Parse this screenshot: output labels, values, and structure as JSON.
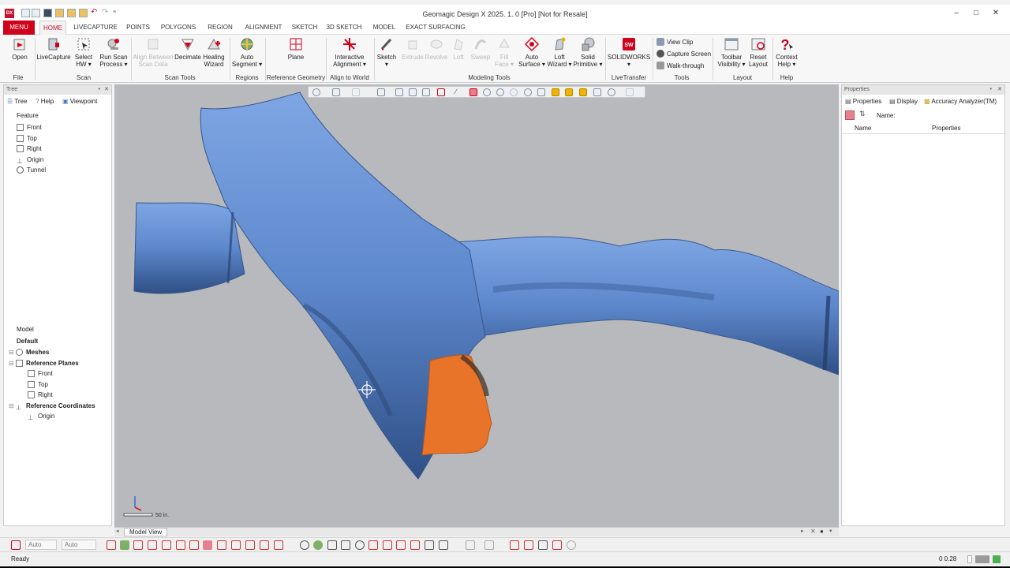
{
  "title_bar": {
    "app_logo": "DX",
    "title": "Geomagic Design X 2025. 1. 0 [Pro] [Not for Resale]"
  },
  "tabs": [
    "MENU",
    "HOME",
    "LIVECAPTURE",
    "POINTS",
    "POLYGONS",
    "REGION",
    "ALIGNMENT",
    "SKETCH",
    "3D SKETCH",
    "MODEL",
    "EXACT SURFACING"
  ],
  "ribbon": {
    "buttons": [
      {
        "l1": "Open",
        "l2": "",
        "icon": "open-icon",
        "enabled": true
      },
      {
        "l1": "LiveCapture",
        "l2": "",
        "icon": "livecapture-icon",
        "enabled": true
      },
      {
        "l1": "Select",
        "l2": "HW ▾",
        "icon": "select-hw-icon",
        "enabled": true
      },
      {
        "l1": "Run Scan",
        "l2": "Process ▾",
        "icon": "run-scan-icon",
        "enabled": true
      },
      {
        "l1": "Align Between",
        "l2": "Scan Data",
        "icon": "align-scan-icon",
        "enabled": false
      },
      {
        "l1": "Decimate",
        "l2": "",
        "icon": "decimate-icon",
        "enabled": true
      },
      {
        "l1": "Healing",
        "l2": "Wizard",
        "icon": "healing-icon",
        "enabled": true
      },
      {
        "l1": "Auto",
        "l2": "Segment ▾",
        "icon": "auto-segment-icon",
        "enabled": true
      },
      {
        "l1": "Plane",
        "l2": "",
        "icon": "plane-icon",
        "enabled": true
      },
      {
        "l1": "Interactive",
        "l2": "Alignment ▾",
        "icon": "interactive-alignment-icon",
        "enabled": true
      },
      {
        "l1": "Sketch",
        "l2": "▾",
        "icon": "sketch-icon",
        "enabled": true
      },
      {
        "l1": "Extrude",
        "l2": "",
        "icon": "extrude-icon",
        "enabled": false
      },
      {
        "l1": "Revolve",
        "l2": "",
        "icon": "revolve-icon",
        "enabled": false
      },
      {
        "l1": "Loft",
        "l2": "",
        "icon": "loft-icon",
        "enabled": false
      },
      {
        "l1": "Sweep",
        "l2": "",
        "icon": "sweep-icon",
        "enabled": false
      },
      {
        "l1": "Fill",
        "l2": "Face ▾",
        "icon": "fill-face-icon",
        "enabled": false
      },
      {
        "l1": "Auto",
        "l2": "Surface ▾",
        "icon": "auto-surface-icon",
        "enabled": true
      },
      {
        "l1": "Loft",
        "l2": "Wizard ▾",
        "icon": "loft-wizard-icon",
        "enabled": true
      },
      {
        "l1": "Solid",
        "l2": "Primitive ▾",
        "icon": "solid-primitive-icon",
        "enabled": true
      },
      {
        "l1": "SOLIDWORKS",
        "l2": "▾",
        "icon": "solidworks-icon",
        "enabled": true
      },
      {
        "l1": "Toolbar",
        "l2": "Visibility ▾",
        "icon": "toolbar-visibility-icon",
        "enabled": true
      },
      {
        "l1": "Reset",
        "l2": "Layout",
        "icon": "reset-layout-icon",
        "enabled": true
      },
      {
        "l1": "Context",
        "l2": "Help ▾",
        "icon": "context-help-icon",
        "enabled": true
      }
    ],
    "tools": [
      "View Clip",
      "Capture Screen",
      "Walk-through"
    ],
    "groups": [
      "File",
      "Scan",
      "Scan Tools",
      "Regions",
      "Reference Geometry",
      "Align to World",
      "Modeling Tools",
      "LiveTransfer",
      "Tools",
      "Layout",
      "Help"
    ]
  },
  "left_panel": {
    "header": "Tree",
    "tabs": [
      "Tree",
      "Help",
      "Viewpoint"
    ],
    "feature_label": "Feature",
    "features": [
      "Front",
      "Top",
      "Right",
      "Origin",
      "Tunnel"
    ],
    "model_label": "Model",
    "model_tree": {
      "root": "Default",
      "meshes": "Meshes",
      "ref_planes": "Reference Planes",
      "planes": [
        "Front",
        "Top",
        "Right"
      ],
      "ref_coords": "Reference Coordinates",
      "origin": "Origin"
    }
  },
  "right_panel": {
    "header": "Properties",
    "tabs": [
      "Properties",
      "Display",
      "Accuracy Analyzer(TM)"
    ],
    "name_label": "Name:",
    "col_name": "Name",
    "col_props": "Properties"
  },
  "viewport": {
    "scale_label": "50 in.",
    "view_tab": "Model View"
  },
  "bottom": {
    "select1": "Auto",
    "select2": "Auto"
  },
  "status": {
    "text": "Ready",
    "coords": "0 0.28"
  },
  "colors": {
    "accent": "#d0021b",
    "mesh": "#6b96d8",
    "selection": "#e8742a",
    "viewport_bg": "#b8b9bc"
  }
}
